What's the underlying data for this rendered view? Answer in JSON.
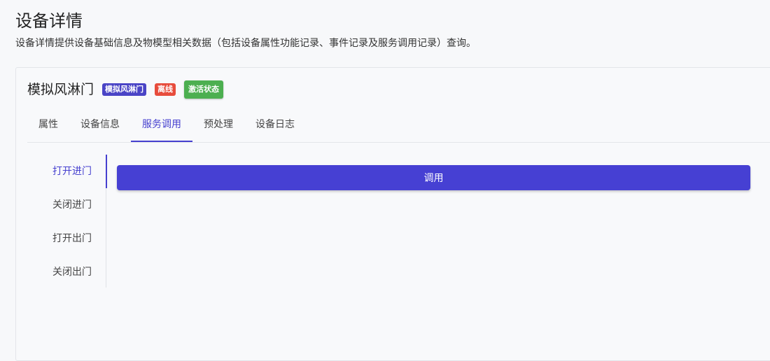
{
  "page": {
    "title": "设备详情",
    "description": "设备详情提供设备基础信息及物模型相关数据（包括设备属性功能记录、事件记录及服务调用记录）查询。"
  },
  "device": {
    "name": "模拟风淋门",
    "model_badge": "模拟风淋门",
    "status_badge": "离线",
    "activate_label": "激活状态"
  },
  "colors": {
    "accent": "#4640cf",
    "offline": "#e74c3c",
    "active": "#4caf50"
  },
  "tabs": [
    {
      "label": "属性",
      "active": false
    },
    {
      "label": "设备信息",
      "active": false
    },
    {
      "label": "服务调用",
      "active": true
    },
    {
      "label": "预处理",
      "active": false
    },
    {
      "label": "设备日志",
      "active": false
    }
  ],
  "services": [
    {
      "label": "打开进门",
      "active": true
    },
    {
      "label": "关闭进门",
      "active": false
    },
    {
      "label": "打开出门",
      "active": false
    },
    {
      "label": "关闭出门",
      "active": false
    }
  ],
  "invoke": {
    "label": "调用"
  }
}
